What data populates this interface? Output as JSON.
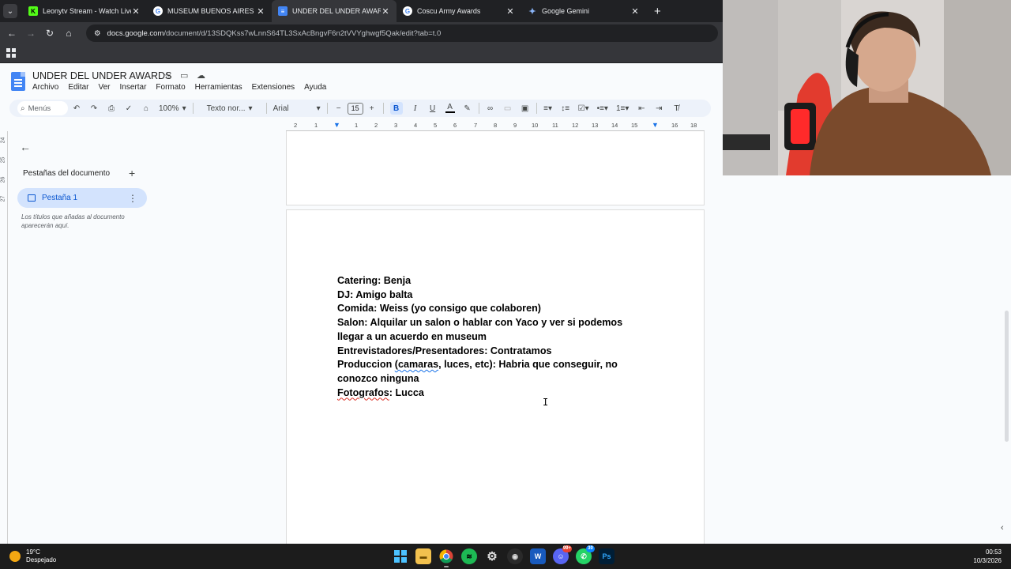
{
  "browser": {
    "tabs": [
      {
        "title": "Leonytv Stream - Watch Live on",
        "favicon": "kick-icon",
        "color": "#53fc18"
      },
      {
        "title": "MUSEUM BUENOS AIRES VACIO",
        "favicon": "google-icon",
        "color": "#ffffff"
      },
      {
        "title": "UNDER DEL UNDER AWARDS",
        "favicon": "docs-icon",
        "color": "#4285f4"
      },
      {
        "title": "Coscu Army Awards",
        "favicon": "google-icon",
        "color": "#ffffff"
      },
      {
        "title": "Google Gemini",
        "favicon": "gemini-icon",
        "color": "#8ab4f8"
      }
    ],
    "active_tab": 2,
    "url_host": "docs.google.com",
    "url_path": "/document/d/13SDQKss7wLnnS64TL3SxAcBngvF6n2tVVYghwgf5Qak/edit?tab=t.0"
  },
  "docs": {
    "title": "UNDER DEL UNDER AWARDS",
    "menu": [
      "Archivo",
      "Editar",
      "Ver",
      "Insertar",
      "Formato",
      "Herramientas",
      "Extensiones",
      "Ayuda"
    ],
    "toolbar": {
      "search_placeholder": "Menús",
      "zoom": "100%",
      "style": "Texto nor...",
      "font": "Arial",
      "font_size": "15",
      "bold": "B",
      "italic": "I",
      "underline": "U"
    },
    "ruler_numbers": [
      "2",
      "1",
      "1",
      "2",
      "3",
      "4",
      "5",
      "6",
      "7",
      "8",
      "9",
      "10",
      "11",
      "12",
      "13",
      "14",
      "15",
      "16",
      "18"
    ],
    "ruler_left_numbers": [
      "24",
      "25",
      "26",
      "27"
    ],
    "sidebar": {
      "title": "Pestañas del documento",
      "tab_label": "Pestaña 1",
      "hint": "Los títulos que añadas al documento aparecerán aquí."
    },
    "content": {
      "l1": "Catering: Benja",
      "l2": "DJ: Amigo balta",
      "l3": "Comida: Weiss (yo consigo que colaboren)",
      "l4": "Salon: Alquilar un salon o hablar con Yaco y ver si podemos",
      "l5": "llegar a un acuerdo en museum",
      "l6": "Entrevistadores/Presentadores: Contratamos",
      "l7a": "Produccion ",
      "l7b": "(camaras",
      "l7c": ", luces, etc): Habria que conseguir, no",
      "l8": "conozco ninguna",
      "l9a": "Fotografos",
      "l9b": ": Lucca"
    }
  },
  "taskbar": {
    "temp": "19°C",
    "weather": "Despejado",
    "time": "00:53",
    "date": "10/3/2026",
    "badges": {
      "discord": "99+",
      "whatsapp": "30"
    }
  }
}
